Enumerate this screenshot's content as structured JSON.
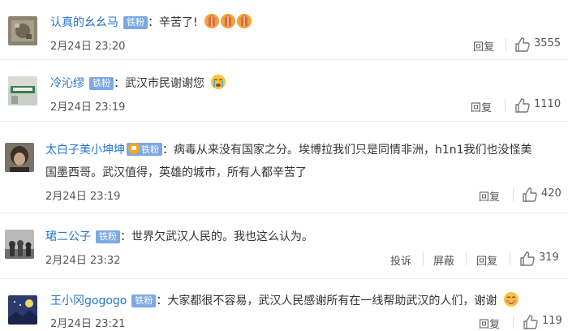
{
  "badge_label": "铁粉",
  "comments": [
    {
      "username": "认真的幺幺马",
      "text": "辛苦了!",
      "emoji": "prayer-hands-emoji",
      "time": "2月24日 23:20",
      "actions": [
        "回复"
      ],
      "likes": "3555"
    },
    {
      "username": "冷沁缪",
      "text": "武汉市民谢谢您",
      "emoji": "crying-face-emoji",
      "time": "2月24日 23:19",
      "actions": [
        "回复"
      ],
      "likes": "1110"
    },
    {
      "username": "太白子美小坤坤",
      "text_line1": "病毒从来没有国家之分。埃博拉我们只是同情非洲，h1n1我们也没怪美",
      "text_line2": "国墨西哥。武汉值得，英雄的城市，所有人都辛苦了",
      "time": "2月24日 23:19",
      "actions": [
        "回复"
      ],
      "likes": "420"
    },
    {
      "username": "珺二公子",
      "text": "世界欠武汉人民的。我也这么认为。",
      "time": "2月24日 23:32",
      "actions": [
        "投诉",
        "屏蔽",
        "回复"
      ],
      "likes": "319"
    },
    {
      "username": "王小冈gogogo",
      "text": "大家都很不容易，武汉人民感谢所有在一线帮助武汉的人们，谢谢",
      "emoji": "blushing-face-emoji",
      "time": "2月24日 23:21",
      "actions": [
        "回复"
      ],
      "likes": "119"
    }
  ],
  "colors": {
    "username": "#2574d0",
    "badge": "#7ca9e2",
    "text": "#333333",
    "meta": "#555555"
  }
}
